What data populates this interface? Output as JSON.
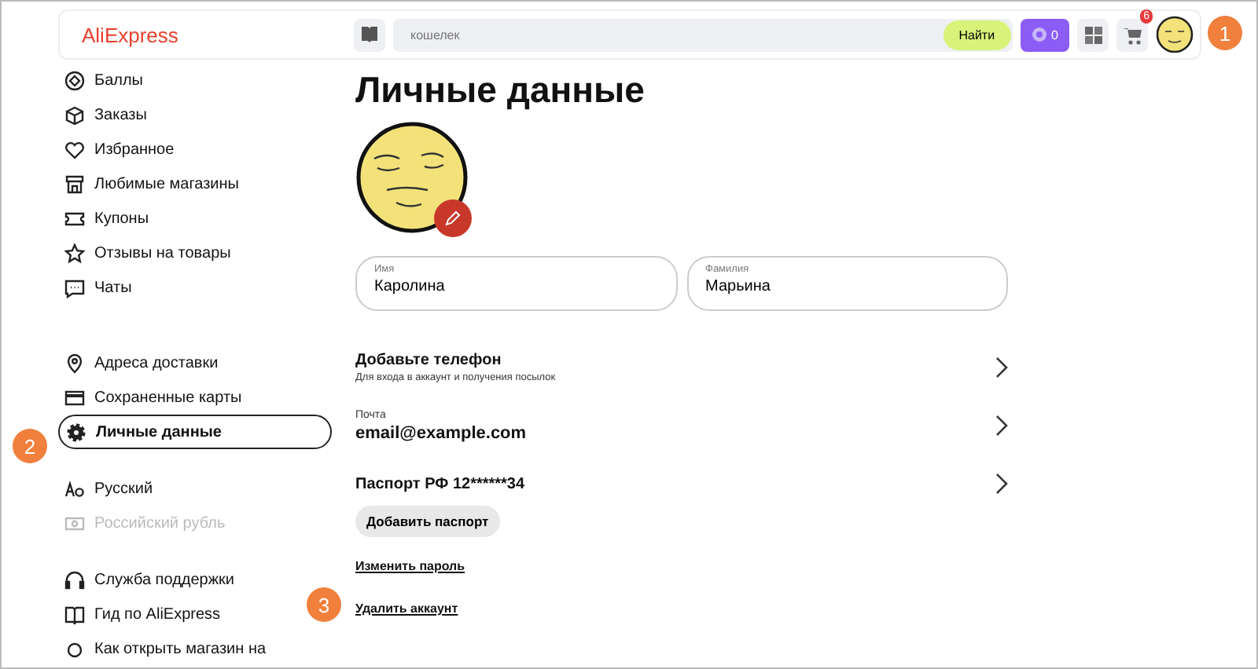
{
  "header": {
    "logo": "AliExpress",
    "search": {
      "placeholder": "кошелек",
      "button": "Найти"
    },
    "points": "0",
    "cart_badge": "6"
  },
  "sidebar": {
    "groups": [
      [
        {
          "label": "Баллы",
          "selected": false,
          "disabled": false
        },
        {
          "label": "Заказы",
          "selected": false,
          "disabled": false
        },
        {
          "label": "Избранное",
          "selected": false,
          "disabled": false
        },
        {
          "label": "Любимые магазины",
          "selected": false,
          "disabled": false
        },
        {
          "label": "Купоны",
          "selected": false,
          "disabled": false
        },
        {
          "label": "Отзывы на товары",
          "selected": false,
          "disabled": false
        },
        {
          "label": "Чаты",
          "selected": false,
          "disabled": false
        }
      ],
      [
        {
          "label": "Адреса доставки",
          "selected": false,
          "disabled": false
        },
        {
          "label": "Сохраненные карты",
          "selected": false,
          "disabled": false
        },
        {
          "label": "Личные данные",
          "selected": true,
          "disabled": false
        }
      ],
      [
        {
          "label": "Русский",
          "selected": false,
          "disabled": false
        },
        {
          "label": "Российский рубль",
          "selected": false,
          "disabled": true
        }
      ],
      [
        {
          "label": "Служба поддержки",
          "selected": false,
          "disabled": false
        },
        {
          "label": "Гид по AliExpress",
          "selected": false,
          "disabled": false
        },
        {
          "label": "Как открыть магазин на",
          "selected": false,
          "disabled": false
        }
      ]
    ]
  },
  "main": {
    "title": "Личные данные",
    "fields": [
      {
        "label": "Имя",
        "value": "Каролина"
      },
      {
        "label": "Фамилия",
        "value": "Марьина"
      }
    ],
    "rows": [
      {
        "kind": "title",
        "title": "Добавьте телефон",
        "subtitle": "Для входа в аккаунт и получения посылок"
      },
      {
        "kind": "labeled",
        "label": "Почта",
        "value": "email@example.com"
      },
      {
        "kind": "title",
        "title": "Паспорт РФ 12******34"
      }
    ],
    "button": "Добавить паспорт",
    "links": [
      "Изменить пароль",
      "Удалить аккаунт"
    ]
  },
  "markers": [
    "1",
    "2",
    "3"
  ]
}
